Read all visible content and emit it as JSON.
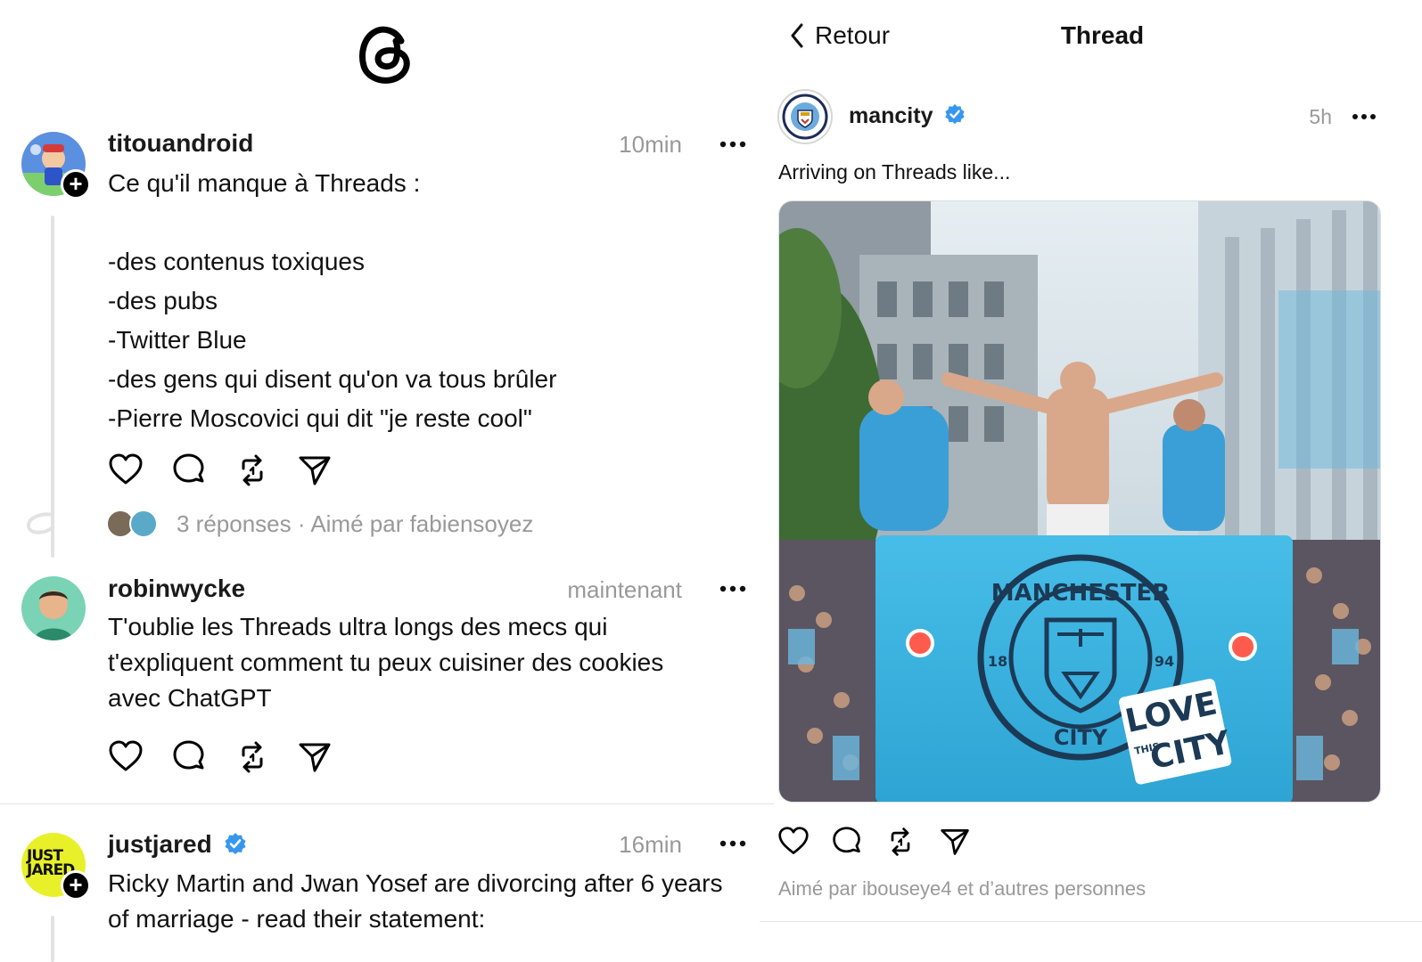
{
  "feed": {
    "posts": [
      {
        "username": "titouandroid",
        "time": "10min",
        "text": "Ce qu'il manque à Threads :\n\n-des contenus toxiques\n-des pubs\n-Twitter Blue\n-des gens qui disent qu'on va tous brûler\n-Pierre Moscovici qui dit \"je reste cool\"",
        "replies_summary": "3 réponses · Aimé par fabiensoyez"
      },
      {
        "username": "robinwycke",
        "time": "maintenant",
        "text": "T'oublie les Threads ultra longs des mecs qui\nt'expliquent comment tu peux cuisiner des cookies\navec ChatGPT"
      },
      {
        "username": "justjared",
        "time": "16min",
        "verified": true,
        "avatar_text": "JUST JARED",
        "text": "Ricky Martin and Jwan Yosef are divorcing after 6 years\nof marriage - read their statement:"
      }
    ]
  },
  "thread_view": {
    "back_label": "Retour",
    "title": "Thread",
    "post": {
      "username": "mancity",
      "verified": true,
      "time": "5h",
      "caption": "Arriving on Threads like...",
      "likes_text": "Aimé par ibouseye4 et d’autres personnes",
      "image_text": {
        "crest_top": "MANCHESTER",
        "crest_left": "18",
        "crest_right": "94",
        "crest_bottom": "CITY",
        "sticker_top": "LOVE",
        "sticker_small": "THIS",
        "sticker_bottom": "CITY"
      }
    }
  },
  "colors": {
    "verified_blue": "#3797f0",
    "muted_text": "#999999",
    "divider": "#e4e4e4",
    "city_blue": "#3fb4e3"
  },
  "icons": [
    "threads-logo-icon",
    "plus-icon",
    "more-icon",
    "heart-icon",
    "comment-icon",
    "repost-icon",
    "share-icon",
    "verified-icon",
    "chevron-left-icon"
  ]
}
